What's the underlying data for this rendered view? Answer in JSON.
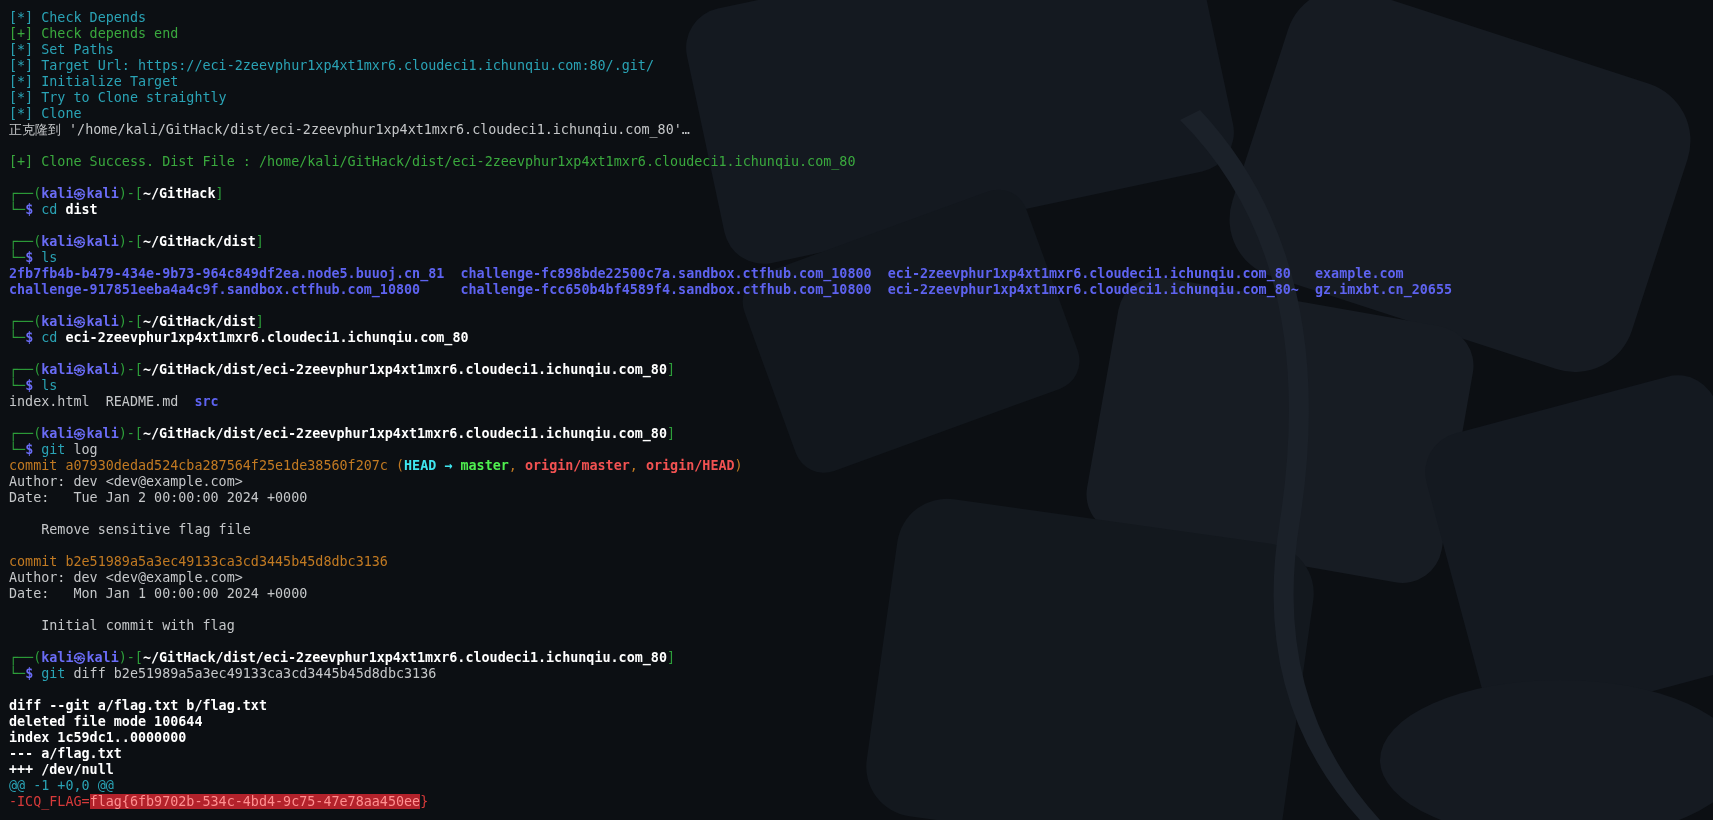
{
  "terminal": {
    "lines": [
      {
        "kind": "text",
        "segments": [
          {
            "text": "[*] Check Depends",
            "kind": "info"
          }
        ]
      },
      {
        "kind": "text",
        "segments": [
          {
            "text": "[+] Check depends end",
            "kind": "ok"
          }
        ]
      },
      {
        "kind": "text",
        "segments": [
          {
            "text": "[*] Set Paths",
            "kind": "info"
          }
        ]
      },
      {
        "kind": "text",
        "segments": [
          {
            "text": "[*] Target Url: https://eci-2zeevphur1xp4xt1mxr6.cloudeci1.ichunqiu.com:80/.git/",
            "kind": "info"
          }
        ]
      },
      {
        "kind": "text",
        "segments": [
          {
            "text": "[*] Initialize Target",
            "kind": "info"
          }
        ]
      },
      {
        "kind": "text",
        "segments": [
          {
            "text": "[*] Try to Clone straightly",
            "kind": "info"
          }
        ]
      },
      {
        "kind": "text",
        "segments": [
          {
            "text": "[*] Clone",
            "kind": "info"
          }
        ]
      },
      {
        "kind": "text",
        "segments": [
          {
            "text": "正克隆到 '/home/kali/GitHack/dist/eci-2zeevphur1xp4xt1mxr6.cloudeci1.ichunqiu.com_80'…",
            "kind": "plain"
          }
        ]
      },
      {
        "kind": "blank"
      },
      {
        "kind": "text",
        "segments": [
          {
            "text": "[+] Clone Success. Dist File : /home/kali/GitHack/dist/eci-2zeevphur1xp4xt1mxr6.cloudeci1.ichunqiu.com_80",
            "kind": "ok"
          }
        ]
      },
      {
        "kind": "blank"
      },
      {
        "kind": "text",
        "segments": [
          {
            "text": "┌──(",
            "kind": "frame"
          },
          {
            "text": "kali㉿kali",
            "kind": "user"
          },
          {
            "text": ")-[",
            "kind": "frame"
          },
          {
            "text": "~/GitHack",
            "kind": "path"
          },
          {
            "text": "]",
            "kind": "frame"
          }
        ]
      },
      {
        "kind": "text",
        "segments": [
          {
            "text": "└─",
            "kind": "frame"
          },
          {
            "text": "$",
            "kind": "user"
          },
          {
            "text": " cd",
            "kind": "cmd"
          },
          {
            "text": " dist",
            "kind": "bold"
          }
        ]
      },
      {
        "kind": "blank"
      },
      {
        "kind": "text",
        "segments": [
          {
            "text": "┌──(",
            "kind": "frame"
          },
          {
            "text": "kali㉿kali",
            "kind": "user"
          },
          {
            "text": ")-[",
            "kind": "frame"
          },
          {
            "text": "~/GitHack/dist",
            "kind": "path"
          },
          {
            "text": "]",
            "kind": "frame"
          }
        ]
      },
      {
        "kind": "text",
        "segments": [
          {
            "text": "└─",
            "kind": "frame"
          },
          {
            "text": "$",
            "kind": "user"
          },
          {
            "text": " ls",
            "kind": "cmd"
          }
        ]
      },
      {
        "kind": "columns",
        "rows": [
          [
            {
              "text": "2fb7fb4b-b479-434e-9b73-964c849df2ea.node5.buuoj.cn_81",
              "kind": "dir"
            },
            {
              "text": "challenge-fc898bde22500c7a.sandbox.ctfhub.com_10800",
              "kind": "dir"
            },
            {
              "text": "eci-2zeevphur1xp4xt1mxr6.cloudeci1.ichunqiu.com_80",
              "kind": "dir"
            },
            {
              "text": "example.com",
              "kind": "dir"
            }
          ],
          [
            {
              "text": "challenge-917851eeba4a4c9f.sandbox.ctfhub.com_10800",
              "kind": "dir"
            },
            {
              "text": "challenge-fcc650b4bf4589f4.sandbox.ctfhub.com_10800",
              "kind": "dir"
            },
            {
              "text": "eci-2zeevphur1xp4xt1mxr6.cloudeci1.ichunqiu.com_80~",
              "kind": "dir"
            },
            {
              "text": "gz.imxbt.cn_20655",
              "kind": "dir"
            }
          ]
        ]
      },
      {
        "kind": "blank"
      },
      {
        "kind": "text",
        "segments": [
          {
            "text": "┌──(",
            "kind": "frame"
          },
          {
            "text": "kali㉿kali",
            "kind": "user"
          },
          {
            "text": ")-[",
            "kind": "frame"
          },
          {
            "text": "~/GitHack/dist",
            "kind": "path"
          },
          {
            "text": "]",
            "kind": "frame"
          }
        ]
      },
      {
        "kind": "text",
        "segments": [
          {
            "text": "└─",
            "kind": "frame"
          },
          {
            "text": "$",
            "kind": "user"
          },
          {
            "text": " cd",
            "kind": "cmd"
          },
          {
            "text": " eci-2zeevphur1xp4xt1mxr6.cloudeci1.ichunqiu.com_80",
            "kind": "bold"
          }
        ]
      },
      {
        "kind": "blank"
      },
      {
        "kind": "text",
        "segments": [
          {
            "text": "┌──(",
            "kind": "frame"
          },
          {
            "text": "kali㉿kali",
            "kind": "user"
          },
          {
            "text": ")-[",
            "kind": "frame"
          },
          {
            "text": "~/GitHack/dist/eci-2zeevphur1xp4xt1mxr6.cloudeci1.ichunqiu.com_80",
            "kind": "path"
          },
          {
            "text": "]",
            "kind": "frame"
          }
        ]
      },
      {
        "kind": "text",
        "segments": [
          {
            "text": "└─",
            "kind": "frame"
          },
          {
            "text": "$",
            "kind": "user"
          },
          {
            "text": " ls",
            "kind": "cmd"
          }
        ]
      },
      {
        "kind": "columns",
        "rows": [
          [
            {
              "text": "index.html",
              "kind": "file"
            },
            {
              "text": "README.md",
              "kind": "file"
            },
            {
              "text": "src",
              "kind": "dir"
            }
          ]
        ]
      },
      {
        "kind": "blank"
      },
      {
        "kind": "text",
        "segments": [
          {
            "text": "┌──(",
            "kind": "frame"
          },
          {
            "text": "kali㉿kali",
            "kind": "user"
          },
          {
            "text": ")-[",
            "kind": "frame"
          },
          {
            "text": "~/GitHack/dist/eci-2zeevphur1xp4xt1mxr6.cloudeci1.ichunqiu.com_80",
            "kind": "path"
          },
          {
            "text": "]",
            "kind": "frame"
          }
        ]
      },
      {
        "kind": "text",
        "segments": [
          {
            "text": "└─",
            "kind": "frame"
          },
          {
            "text": "$",
            "kind": "user"
          },
          {
            "text": " git",
            "kind": "cmd"
          },
          {
            "text": " log",
            "kind": "plain"
          }
        ]
      },
      {
        "kind": "text",
        "segments": [
          {
            "text": "commit a07930dedad524cba287564f25e1de38560f207c (",
            "kind": "commit"
          },
          {
            "text": "HEAD →",
            "kind": "head"
          },
          {
            "text": " master",
            "kind": "branch"
          },
          {
            "text": ", ",
            "kind": "commit"
          },
          {
            "text": "origin/master",
            "kind": "remote"
          },
          {
            "text": ", ",
            "kind": "commit"
          },
          {
            "text": "origin/HEAD",
            "kind": "remote"
          },
          {
            "text": ")",
            "kind": "commit"
          }
        ]
      },
      {
        "kind": "text",
        "segments": [
          {
            "text": "Author: dev <dev@example.com>",
            "kind": "plain"
          }
        ]
      },
      {
        "kind": "text",
        "segments": [
          {
            "text": "Date:   Tue Jan 2 00:00:00 2024 +0000",
            "kind": "plain"
          }
        ]
      },
      {
        "kind": "blank"
      },
      {
        "kind": "text",
        "segments": [
          {
            "text": "    Remove sensitive flag file",
            "kind": "plain"
          }
        ]
      },
      {
        "kind": "blank"
      },
      {
        "kind": "text",
        "segments": [
          {
            "text": "commit b2e51989a5a3ec49133ca3cd3445b45d8dbc3136",
            "kind": "commit"
          }
        ]
      },
      {
        "kind": "text",
        "segments": [
          {
            "text": "Author: dev <dev@example.com>",
            "kind": "plain"
          }
        ]
      },
      {
        "kind": "text",
        "segments": [
          {
            "text": "Date:   Mon Jan 1 00:00:00 2024 +0000",
            "kind": "plain"
          }
        ]
      },
      {
        "kind": "blank"
      },
      {
        "kind": "text",
        "segments": [
          {
            "text": "    Initial commit with flag",
            "kind": "plain"
          }
        ]
      },
      {
        "kind": "blank"
      },
      {
        "kind": "text",
        "segments": [
          {
            "text": "┌──(",
            "kind": "frame"
          },
          {
            "text": "kali㉿kali",
            "kind": "user"
          },
          {
            "text": ")-[",
            "kind": "frame"
          },
          {
            "text": "~/GitHack/dist/eci-2zeevphur1xp4xt1mxr6.cloudeci1.ichunqiu.com_80",
            "kind": "path"
          },
          {
            "text": "]",
            "kind": "frame"
          }
        ]
      },
      {
        "kind": "text",
        "segments": [
          {
            "text": "└─",
            "kind": "frame"
          },
          {
            "text": "$",
            "kind": "user"
          },
          {
            "text": " git",
            "kind": "cmd"
          },
          {
            "text": " diff b2e51989a5a3ec49133ca3cd3445b45d8dbc3136",
            "kind": "plain"
          }
        ]
      },
      {
        "kind": "blank"
      },
      {
        "kind": "text",
        "segments": [
          {
            "text": "diff --git a/flag.txt b/flag.txt",
            "kind": "bold"
          }
        ]
      },
      {
        "kind": "text",
        "segments": [
          {
            "text": "deleted file mode 100644",
            "kind": "bold"
          }
        ]
      },
      {
        "kind": "text",
        "segments": [
          {
            "text": "index 1c59dc1..0000000",
            "kind": "bold"
          }
        ]
      },
      {
        "kind": "text",
        "segments": [
          {
            "text": "--- a/flag.txt",
            "kind": "bold"
          }
        ]
      },
      {
        "kind": "text",
        "segments": [
          {
            "text": "+++ /dev/null",
            "kind": "bold"
          }
        ]
      },
      {
        "kind": "text",
        "segments": [
          {
            "text": "@@ -1 +0,0 @@",
            "kind": "hunk"
          }
        ]
      },
      {
        "kind": "text",
        "segments": [
          {
            "text": "-ICQ_FLAG=",
            "kind": "removed"
          },
          {
            "text": "flag{6fb9702b-534c-4bd4-9c75-47e78aa450ee",
            "kind": "highlight"
          },
          {
            "text": "}",
            "kind": "removed"
          }
        ]
      }
    ]
  }
}
